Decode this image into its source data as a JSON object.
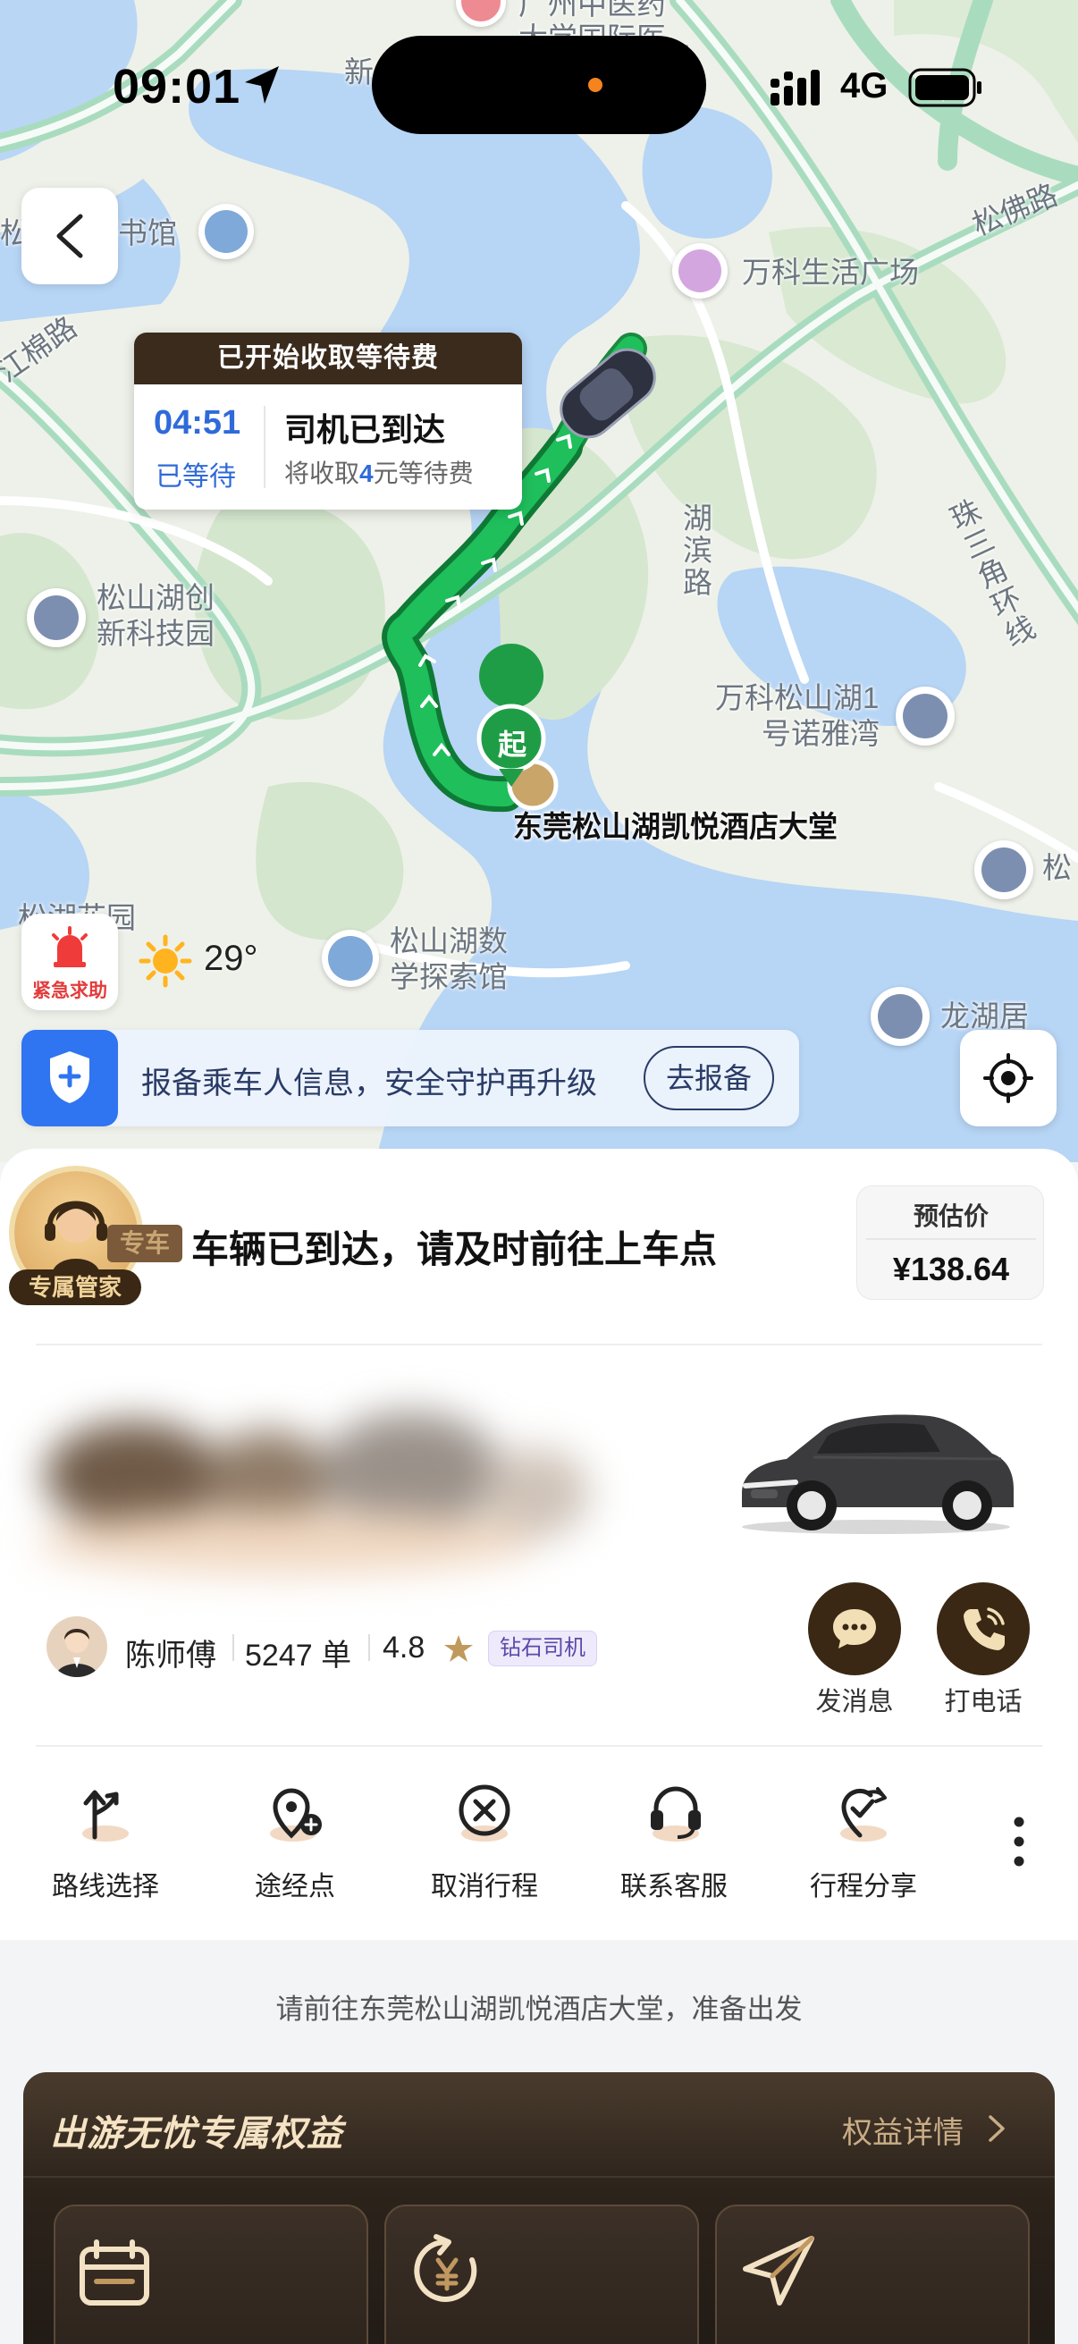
{
  "status_bar": {
    "time": "09:01",
    "network": "4G"
  },
  "map": {
    "labels": {
      "hospital_top": "广州中医药",
      "hospital_sub": "大学国际医...",
      "xin": "新",
      "library": "松山湖图书馆",
      "vanke_plaza": "万科生活广场",
      "songfo_road": "松佛路",
      "jiangmian_road": "江棉路",
      "hubin_road": "湖滨路",
      "zhusanjiao": "珠三角环线",
      "innovation_1": "松山湖创",
      "innovation_2": "新科技园",
      "vanke_nuoya_1": "万科松山湖1",
      "vanke_nuoya_2": "号诺雅湾",
      "pickup_point": "东莞松山湖凯悦酒店大堂",
      "songhu_garden": "松湖花园",
      "song_short": "松",
      "math_1": "松山湖数",
      "math_2": "学探索馆",
      "longhuju": "龙湖居"
    },
    "start_marker": "起"
  },
  "wait_card": {
    "header": "已开始收取等待费",
    "timer": "04:51",
    "timer_label": "已等待",
    "status": "司机已到达",
    "fee_prefix": "将收取",
    "fee_amount": "4",
    "fee_suffix": "元等待费"
  },
  "weather": {
    "temp": "29°"
  },
  "sos": {
    "label": "紧急求助"
  },
  "safety_banner": {
    "text": "报备乘车人信息，安全守护再升级",
    "button": "去报备"
  },
  "trip": {
    "car_type_badge": "专车",
    "steward_label": "专属管家",
    "status_title": "车辆已到达，请及时前往上车点",
    "price_label": "预估价",
    "price": "¥138.64"
  },
  "driver": {
    "name": "陈师傅",
    "orders": "5247 单",
    "rating": "4.8",
    "badge": "钻石司机",
    "message_label": "发消息",
    "call_label": "打电话"
  },
  "actions": [
    {
      "label": "路线选择",
      "icon": "route-icon"
    },
    {
      "label": "途经点",
      "icon": "waypoint-icon"
    },
    {
      "label": "取消行程",
      "icon": "cancel-icon"
    },
    {
      "label": "联系客服",
      "icon": "headset-icon"
    },
    {
      "label": "行程分享",
      "icon": "share-icon"
    }
  ],
  "hint": "请前往东莞松山湖凯悦酒店大堂，准备出发",
  "benefits": {
    "title": "出游无忧专属权益",
    "detail_link": "权益详情"
  },
  "colors": {
    "route": "#16b24f",
    "accent_dark": "#3a2814",
    "blue": "#2f6ad9"
  }
}
